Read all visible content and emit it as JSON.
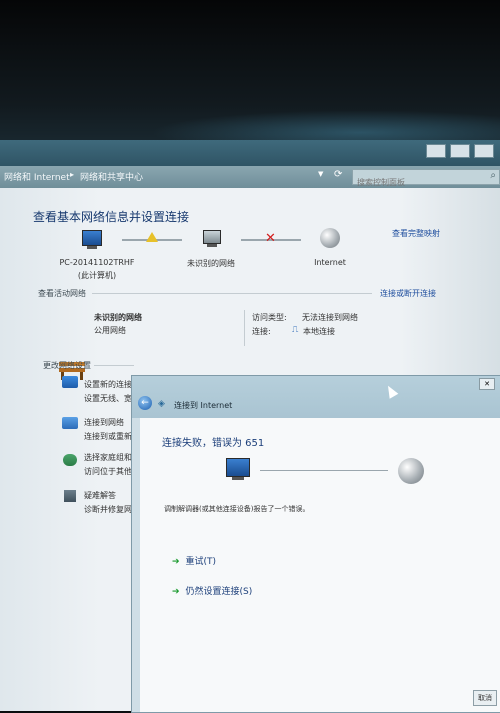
{
  "window": {
    "breadcrumb": [
      "网络和 Internet",
      "网络和共享中心"
    ],
    "search_placeholder": "搜索控制面板"
  },
  "main": {
    "title": "查看基本网络信息并设置连接",
    "view_full_map": "查看完整映射",
    "network_map": {
      "pc_name": "PC-20141102TRHF",
      "pc_sub": "(此计算机)",
      "unidentified": "未识别的网络",
      "internet": "Internet"
    },
    "active_networks": {
      "label": "查看活动网络",
      "connect_link": "连接或断开连接",
      "network_name": "未识别的网络",
      "network_type": "公用网络",
      "access_type_label": "访问类型:",
      "access_type_value": "无法连接到网络",
      "connections_label": "连接:",
      "connections_value": "本地连接"
    },
    "change_settings": {
      "label": "更改网络设置",
      "items": [
        {
          "title": "设置新的连接",
          "desc": "设置无线、宽"
        },
        {
          "title": "连接到网络",
          "desc": "连接到或重新"
        },
        {
          "title": "选择家庭组和",
          "desc": "访问位于其他"
        },
        {
          "title": "疑难解答",
          "desc": "诊断并修复网"
        }
      ]
    }
  },
  "dialog": {
    "title": "连接到 Internet",
    "error_title": "连接失败，错误为 651",
    "error_desc": "调制解调器(或其他连接设备)报告了一个错误。",
    "options": [
      "重试(T)",
      "仍然设置连接(S)"
    ],
    "cancel": "取消"
  }
}
